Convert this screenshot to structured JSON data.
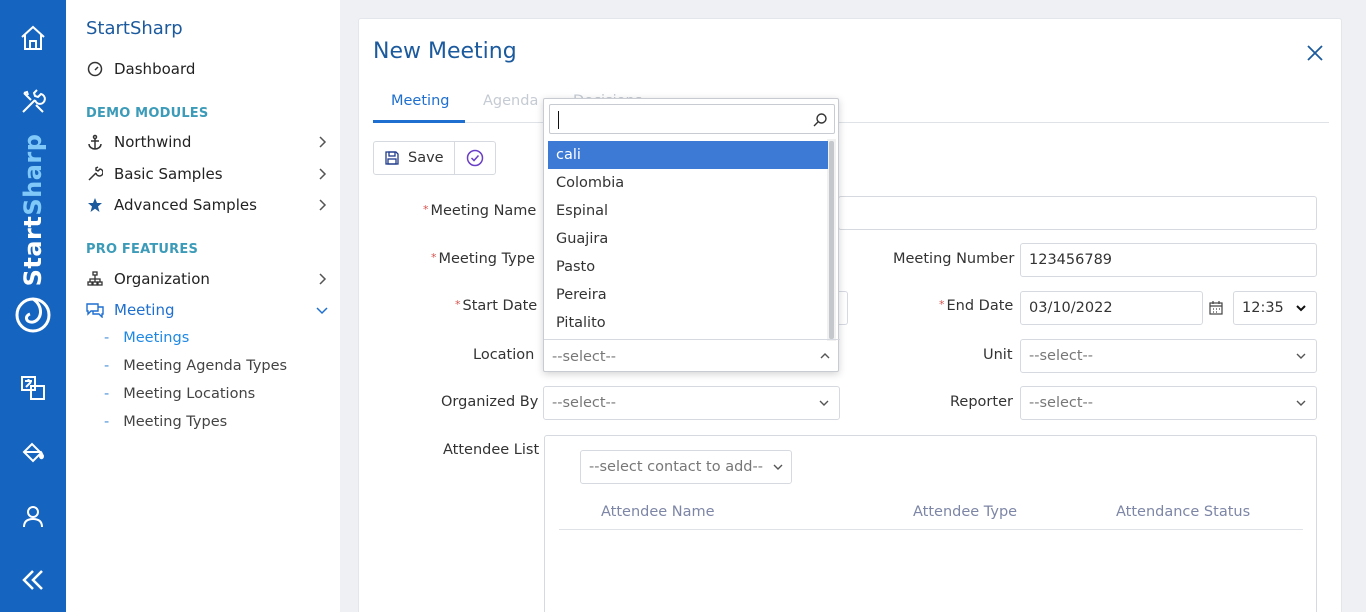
{
  "sidebar": {
    "title": "StartSharp",
    "dashboard": "Dashboard",
    "section_demo": "DEMO MODULES",
    "northwind": "Northwind",
    "basic_samples": "Basic Samples",
    "advanced_samples": "Advanced Samples",
    "section_pro": "PRO FEATURES",
    "organization": "Organization",
    "meeting": "Meeting",
    "sub": [
      "Meetings",
      "Meeting Agenda Types",
      "Meeting Locations",
      "Meeting Types"
    ],
    "dash": "-"
  },
  "rail": {
    "brand_start": "Start",
    "brand_sharp": "Sharp"
  },
  "dialog": {
    "title": "New Meeting",
    "tabs": [
      "Meeting",
      "Agenda",
      "Decisions"
    ],
    "save": "Save"
  },
  "form": {
    "meeting_name_label": "Meeting Name",
    "meeting_type_label": "Meeting Type",
    "meeting_number_label": "Meeting Number",
    "meeting_number_value": "123456789",
    "start_date_label": "Start Date",
    "end_date_label": "End Date",
    "end_date_value": "03/10/2022",
    "end_time_value": "12:35",
    "location_label": "Location",
    "location_value": "--select--",
    "unit_label": "Unit",
    "unit_value": "--select--",
    "organized_by_label": "Organized By",
    "organized_by_value": "--select--",
    "reporter_label": "Reporter",
    "reporter_value": "--select--",
    "attendee_list_label": "Attendee List",
    "contact_placeholder": "--select contact to add--",
    "att_cols": [
      "Attendee Name",
      "Attendee Type",
      "Attendance Status"
    ],
    "required_mark": "*"
  },
  "dropdown": {
    "options": [
      "cali",
      "Colombia",
      "Espinal",
      "Guajira",
      "Pasto",
      "Pereira",
      "Pitalito"
    ],
    "highlighted": "cali"
  },
  "colors": {
    "accent": "#1e6fd0",
    "rail": "#1565c0",
    "highlight": "#3d7ad6"
  }
}
